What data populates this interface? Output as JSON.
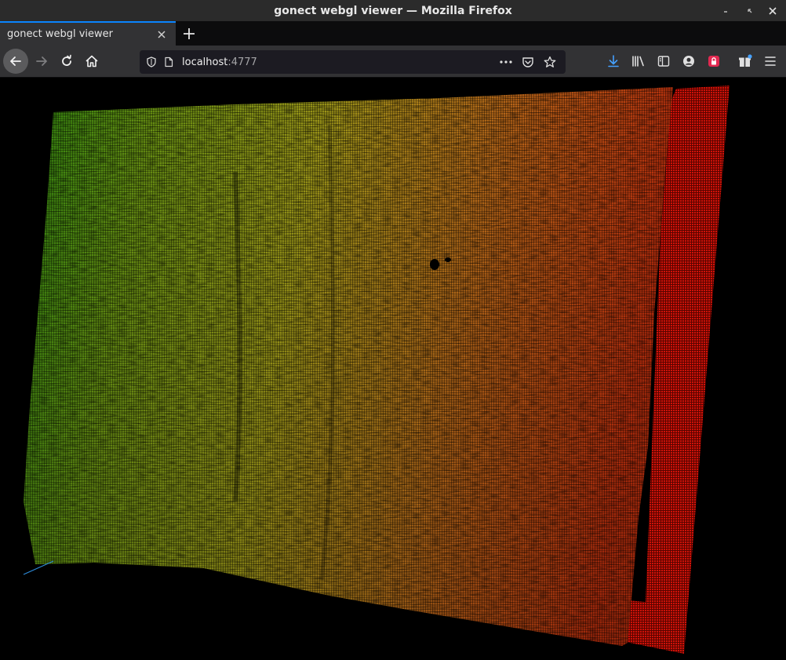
{
  "window": {
    "title": "gonect webgl viewer — Mozilla Firefox"
  },
  "tabs": [
    {
      "label": "gonect webgl viewer",
      "active": true
    }
  ],
  "navbar": {
    "url_host": "localhost",
    "url_port": ":4777"
  },
  "icons": {
    "back": "arrow-left-icon",
    "forward": "arrow-right-icon",
    "reload": "reload-icon",
    "home": "home-icon",
    "tracking": "shield-icon",
    "page": "page-icon",
    "more": "ellipsis-icon",
    "pocket": "pocket-icon",
    "bookmark": "star-icon",
    "downloads": "download-icon",
    "library": "library-icon",
    "sidebar": "sidebar-icon",
    "account": "account-icon",
    "lockwise": "lock-icon",
    "extensions": "gift-icon",
    "menu": "hamburger-menu-icon"
  },
  "colors": {
    "accent": "#0a84ff",
    "point_cloud_left": "#2e8a12",
    "point_cloud_mid": "#a9a21a",
    "point_cloud_right": "#c83a10",
    "back_wall": "#d01208"
  }
}
